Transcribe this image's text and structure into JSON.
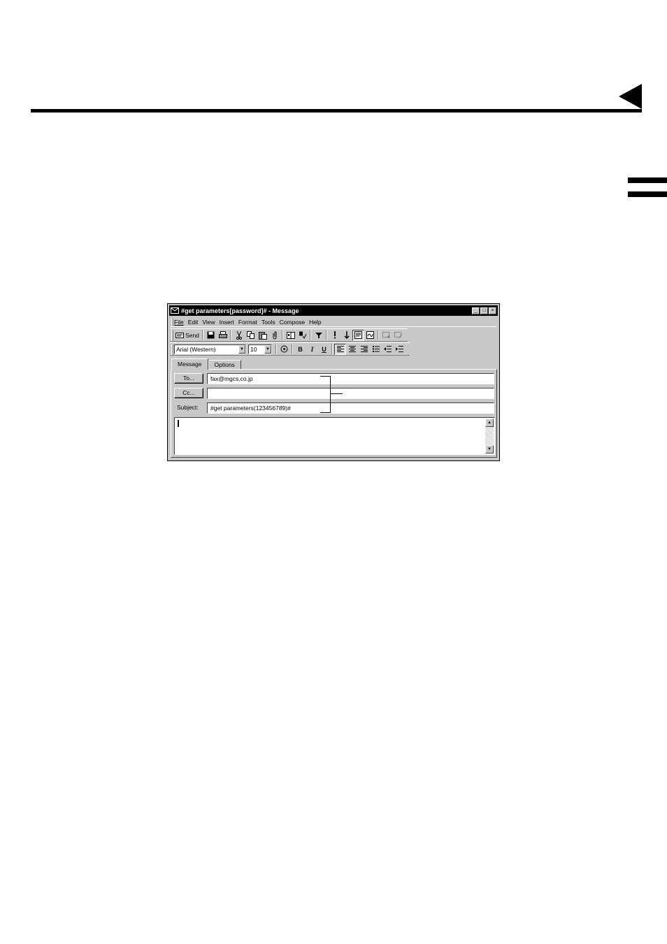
{
  "window": {
    "title": "#get parameters[password]# - Message",
    "controls": {
      "minimize": "_",
      "maximize": "□",
      "close": "×"
    }
  },
  "menu": {
    "items": [
      {
        "first": "F",
        "rest": "ile"
      },
      {
        "first": "E",
        "rest": "dit"
      },
      {
        "first": "V",
        "rest": "iew"
      },
      {
        "first": "I",
        "rest": "nsert"
      },
      {
        "first": "F",
        "rest": "o",
        "pre": "F",
        "label": "Format"
      },
      {
        "first": "T",
        "rest": "ools"
      },
      {
        "first": "C",
        "rest": "ompose"
      },
      {
        "first": "H",
        "rest": "elp"
      }
    ],
    "labels": [
      "File",
      "Edit",
      "View",
      "Insert",
      "Format",
      "Tools",
      "Compose",
      "Help"
    ]
  },
  "toolbar": {
    "send_label": "Send",
    "icons": [
      "save-icon",
      "print-icon",
      "cut-icon",
      "copy-icon",
      "paste-icon",
      "attach-icon",
      "address-book-icon",
      "check-names-icon",
      "filter-icon",
      "high-importance-icon",
      "low-importance-icon",
      "properties-icon",
      "signature-icon",
      "encrypt-icon",
      "digital-sign-icon"
    ]
  },
  "format_bar": {
    "font": "Arial (Western)",
    "size": "10",
    "bold": "B",
    "italic": "I",
    "underline": "U"
  },
  "tabs": [
    "Message",
    "Options"
  ],
  "fields": {
    "to_button": "To...",
    "to_value": "fax@mgcs.co.jp",
    "cc_button": "Cc...",
    "cc_value": "",
    "subject_label": "Subject:",
    "subject_value": "#get parameters(123456789)#"
  },
  "body": {
    "text": ""
  },
  "colors": {
    "window_face": "#c8c8c8",
    "title_bar": "#000000",
    "field_bg": "#ffffff"
  }
}
